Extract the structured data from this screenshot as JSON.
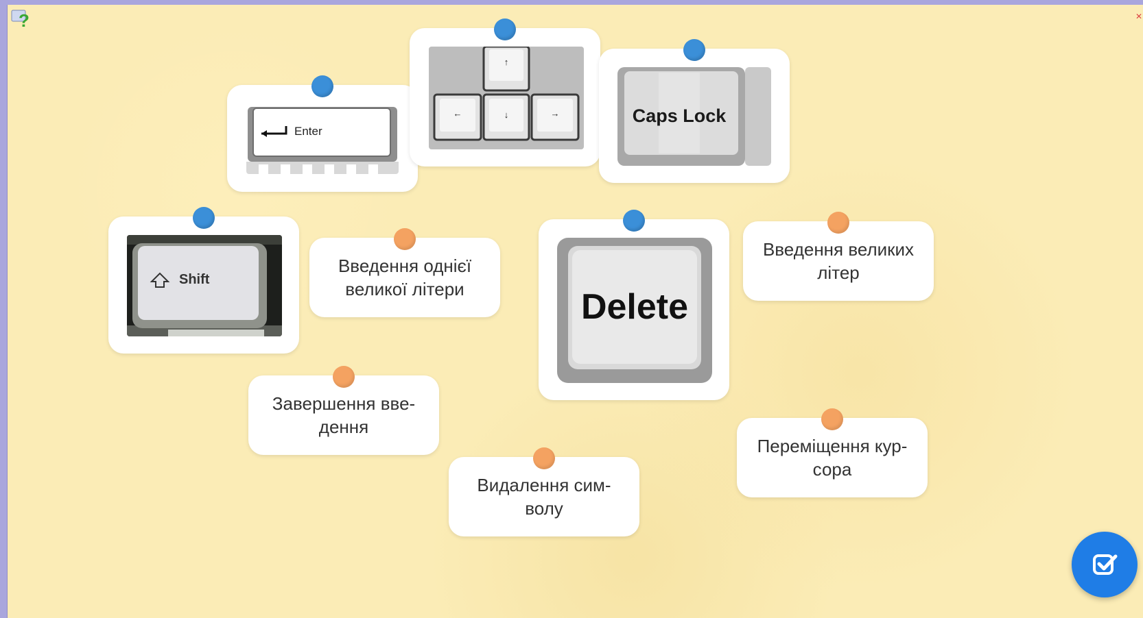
{
  "app": {
    "help_icon": "help-question-icon",
    "close_icon": "close-icon",
    "check_icon": "checkbox-check-icon"
  },
  "cards": {
    "enter": {
      "key_label": "Enter",
      "pin_color": "#3b8fd8"
    },
    "arrows": {
      "up": "↑",
      "left": "←",
      "down": "↓",
      "right": "→",
      "pin_color": "#3b8fd8"
    },
    "capslock": {
      "key_label": "Caps Lock",
      "pin_color": "#3b8fd8"
    },
    "shift": {
      "key_label": "Shift",
      "pin_color": "#3b8fd8"
    },
    "delete": {
      "key_label": "Delete",
      "pin_color": "#3b8fd8"
    },
    "single_capital": {
      "text": "Введення однієї\nвеликої літери",
      "pin_color": "#f4a261"
    },
    "capitals": {
      "text": "Введення великих\nлітер",
      "pin_color": "#f4a261"
    },
    "finish_input": {
      "text": "Завершення вве-\nдення",
      "pin_color": "#f4a261"
    },
    "delete_char": {
      "text": "Видалення сим-\nволу",
      "pin_color": "#f4a261"
    },
    "move_cursor": {
      "text": "Переміщення кур-\nсора",
      "pin_color": "#f4a261"
    }
  }
}
